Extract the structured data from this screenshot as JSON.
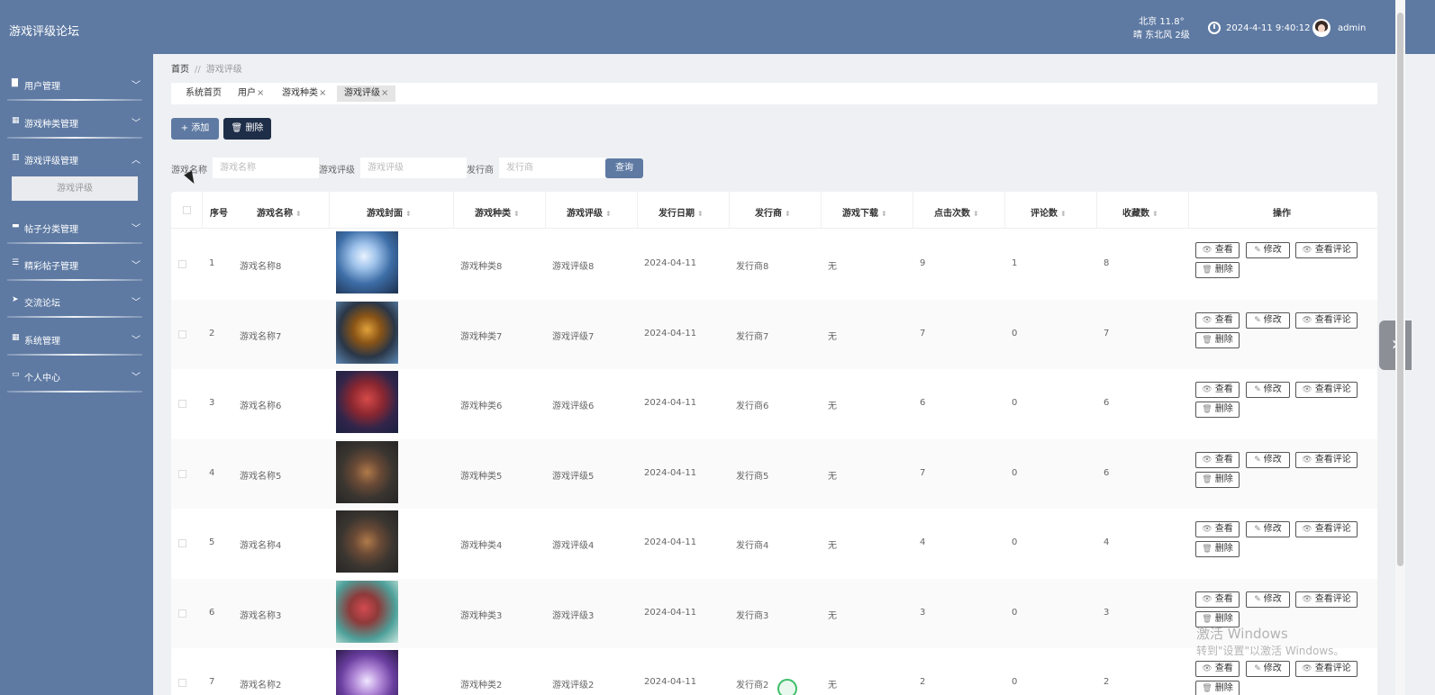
{
  "header": {
    "app_title": "游戏评级论坛",
    "weather_line1": "北京  11.8°",
    "weather_line2": "晴  东北风  2级",
    "datetime": "2024-4-11 9:40:12",
    "username": "admin"
  },
  "sidebar": {
    "items": [
      {
        "label": "用户管理",
        "icon": "briefcase-icon",
        "chevron": "﹀"
      },
      {
        "label": "游戏种类管理",
        "icon": "grid-icon",
        "chevron": "﹀"
      },
      {
        "label": "游戏评级管理",
        "icon": "bar-chart-icon",
        "chevron": "︿"
      },
      {
        "label": "帖子分类管理",
        "icon": "chat-icon",
        "chevron": "﹀"
      },
      {
        "label": "精彩帖子管理",
        "icon": "sliders-icon",
        "chevron": "﹀"
      },
      {
        "label": "交流论坛",
        "icon": "send-icon",
        "chevron": "﹀"
      },
      {
        "label": "系统管理",
        "icon": "grid-icon",
        "chevron": "﹀"
      },
      {
        "label": "个人中心",
        "icon": "card-icon",
        "chevron": "﹀"
      }
    ],
    "active_subitem": "游戏评级"
  },
  "breadcrumb": {
    "home": "首页",
    "sep": "//",
    "current": "游戏评级"
  },
  "tabs": [
    {
      "label": "系统首页",
      "closable": false
    },
    {
      "label": "用户",
      "closable": true
    },
    {
      "label": "游戏种类",
      "closable": true
    },
    {
      "label": "游戏评级",
      "closable": true
    }
  ],
  "tab_close": "×",
  "actions": {
    "add": "+ 添加",
    "delete": "删除"
  },
  "search": {
    "name_label": "游戏名称",
    "name_placeholder": "游戏名称",
    "rating_label": "游戏评级",
    "rating_placeholder": "游戏评级",
    "publisher_label": "发行商",
    "publisher_placeholder": "发行商",
    "query": "查询"
  },
  "table": {
    "columns": [
      "序号",
      "游戏名称",
      "游戏封面",
      "游戏种类",
      "游戏评级",
      "发行日期",
      "发行商",
      "游戏下载",
      "点击次数",
      "评论数",
      "收藏数",
      "操作"
    ],
    "sort_glyph": "⬍",
    "row_buttons": {
      "view": "查看",
      "edit": "修改",
      "view_comments": "查看评论",
      "delete": "删除"
    },
    "rows": [
      {
        "no": "1",
        "name": "游戏名称8",
        "type": "游戏种类8",
        "rating": "游戏评级8",
        "date": "2024-04-11",
        "publisher": "发行商8",
        "download": "无",
        "clicks": "9",
        "comments": "1",
        "favorites": "8",
        "cover": "ice-mage"
      },
      {
        "no": "2",
        "name": "游戏名称7",
        "type": "游戏种类7",
        "rating": "游戏评级7",
        "date": "2024-04-11",
        "publisher": "发行商7",
        "download": "无",
        "clicks": "7",
        "comments": "0",
        "favorites": "7",
        "cover": "golden-mech"
      },
      {
        "no": "3",
        "name": "游戏名称6",
        "type": "游戏种类6",
        "rating": "游戏评级6",
        "date": "2024-04-11",
        "publisher": "发行商6",
        "download": "无",
        "clicks": "6",
        "comments": "0",
        "favorites": "6",
        "cover": "red-warriors"
      },
      {
        "no": "4",
        "name": "游戏名称5",
        "type": "游戏种类5",
        "rating": "游戏评级5",
        "date": "2024-04-11",
        "publisher": "发行商5",
        "download": "无",
        "clicks": "7",
        "comments": "0",
        "favorites": "6",
        "cover": "armored-knight"
      },
      {
        "no": "5",
        "name": "游戏名称4",
        "type": "游戏种类4",
        "rating": "游戏评级4",
        "date": "2024-04-11",
        "publisher": "发行商4",
        "download": "无",
        "clicks": "4",
        "comments": "0",
        "favorites": "4",
        "cover": "armored-knight"
      },
      {
        "no": "6",
        "name": "游戏名称3",
        "type": "游戏种类3",
        "rating": "游戏评级3",
        "date": "2024-04-11",
        "publisher": "发行商3",
        "download": "无",
        "clicks": "3",
        "comments": "0",
        "favorites": "3",
        "cover": "red-huntress"
      },
      {
        "no": "7",
        "name": "游戏名称2",
        "type": "游戏种类2",
        "rating": "游戏评级2",
        "date": "2024-04-11",
        "publisher": "发行商2",
        "download": "无",
        "clicks": "2",
        "comments": "0",
        "favorites": "2",
        "cover": "purple-fox"
      }
    ]
  },
  "watermark": {
    "line1": "激活 Windows",
    "line2": "转到\"设置\"以激活 Windows。"
  },
  "colors": {
    "primary": "#5e7aa3",
    "dark_button": "#1f2e48",
    "sidebar_bg": "#5e7aa3",
    "page_bg": "#eef0f3"
  }
}
